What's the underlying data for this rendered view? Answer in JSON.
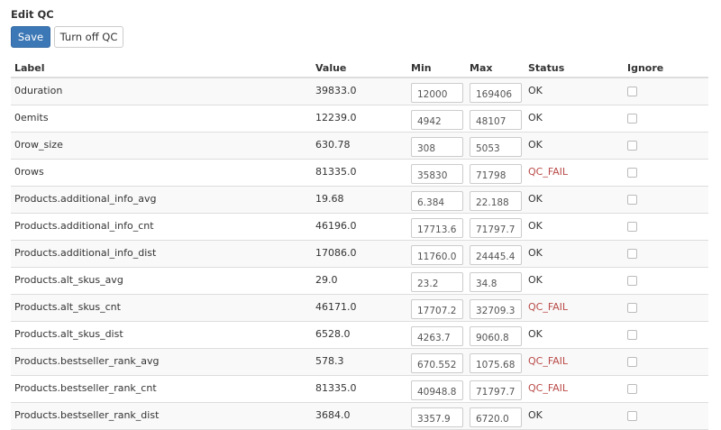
{
  "page": {
    "title": "Edit QC",
    "save_label": "Save",
    "turn_off_label": "Turn off QC"
  },
  "colors": {
    "primary": "#3d78b6",
    "fail": "#b94a48"
  },
  "table": {
    "headers": {
      "label": "Label",
      "value": "Value",
      "min": "Min",
      "max": "Max",
      "status": "Status",
      "ignore": "Ignore"
    },
    "rows": [
      {
        "label": "0duration",
        "value": "39833.0",
        "min": "12000",
        "max": "169406",
        "status": "OK",
        "ignore": false
      },
      {
        "label": "0emits",
        "value": "12239.0",
        "min": "4942",
        "max": "48107",
        "status": "OK",
        "ignore": false
      },
      {
        "label": "0row_size",
        "value": "630.78",
        "min": "308",
        "max": "5053",
        "status": "OK",
        "ignore": false
      },
      {
        "label": "0rows",
        "value": "81335.0",
        "min": "35830",
        "max": "71798",
        "status": "QC_FAIL",
        "ignore": false
      },
      {
        "label": "Products.additional_info_avg",
        "value": "19.68",
        "min": "6.384",
        "max": "22.188",
        "status": "OK",
        "ignore": false
      },
      {
        "label": "Products.additional_info_cnt",
        "value": "46196.0",
        "min": "17713.6",
        "max": "71797.7",
        "status": "OK",
        "ignore": false
      },
      {
        "label": "Products.additional_info_dist",
        "value": "17086.0",
        "min": "11760.0",
        "max": "24445.4",
        "status": "OK",
        "ignore": false
      },
      {
        "label": "Products.alt_skus_avg",
        "value": "29.0",
        "min": "23.2",
        "max": "34.8",
        "status": "OK",
        "ignore": false
      },
      {
        "label": "Products.alt_skus_cnt",
        "value": "46171.0",
        "min": "17707.2",
        "max": "32709.3",
        "status": "QC_FAIL",
        "ignore": false
      },
      {
        "label": "Products.alt_skus_dist",
        "value": "6528.0",
        "min": "4263.7",
        "max": "9060.8",
        "status": "OK",
        "ignore": false
      },
      {
        "label": "Products.bestseller_rank_avg",
        "value": "578.3",
        "min": "670.552",
        "max": "1075.68",
        "status": "QC_FAIL",
        "ignore": false
      },
      {
        "label": "Products.bestseller_rank_cnt",
        "value": "81335.0",
        "min": "40948.8",
        "max": "71797.7",
        "status": "QC_FAIL",
        "ignore": false
      },
      {
        "label": "Products.bestseller_rank_dist",
        "value": "3684.0",
        "min": "3357.9",
        "max": "6720.0",
        "status": "OK",
        "ignore": false
      }
    ]
  }
}
